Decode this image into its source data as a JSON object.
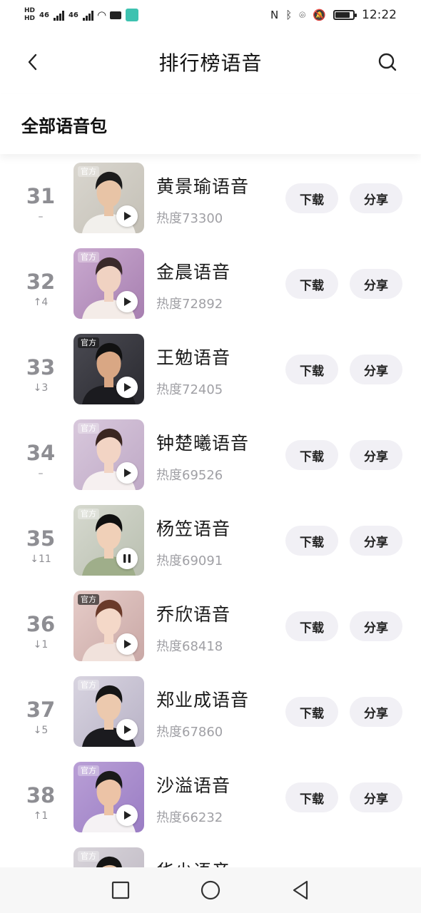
{
  "status": {
    "time": "12:22",
    "net1": "46",
    "net2": "46",
    "battery_level": 0.85
  },
  "header": {
    "title": "排行榜语音"
  },
  "section": {
    "title": "全部语音包"
  },
  "buttons": {
    "download": "下载",
    "share": "分享"
  },
  "badge_label": "官方",
  "items": [
    {
      "rank": "31",
      "change": "–",
      "name": "黄景瑜语音",
      "heat": "热度73300",
      "playing": false,
      "bg1": "#d9d6cf",
      "bg2": "#c4c0b6",
      "hair": "#1c1c1c",
      "skin": "#e8c4a6",
      "cloth": "#f2f0ec"
    },
    {
      "rank": "32",
      "change": "↑4",
      "name": "金晨语音",
      "heat": "热度72892",
      "playing": false,
      "bg1": "#c9a9cf",
      "bg2": "#a77fb0",
      "hair": "#3a2a2a",
      "skin": "#f0d2c2",
      "cloth": "#f4ece8"
    },
    {
      "rank": "33",
      "change": "↓3",
      "name": "王勉语音",
      "heat": "热度72405",
      "playing": false,
      "bg1": "#4a4a52",
      "bg2": "#2a2a30",
      "hair": "#111111",
      "skin": "#d9a784",
      "cloth": "#1b1b1f"
    },
    {
      "rank": "34",
      "change": "–",
      "name": "钟楚曦语音",
      "heat": "热度69526",
      "playing": false,
      "bg1": "#d8c8dc",
      "bg2": "#bfa9c6",
      "hair": "#3a2620",
      "skin": "#f2d4c4",
      "cloth": "#f6f0f0"
    },
    {
      "rank": "35",
      "change": "↓11",
      "name": "杨笠语音",
      "heat": "热度69091",
      "playing": true,
      "bg1": "#d6d9cf",
      "bg2": "#b9bfb0",
      "hair": "#101010",
      "skin": "#f0d0b8",
      "cloth": "#9fae8a"
    },
    {
      "rank": "36",
      "change": "↓1",
      "name": "乔欣语音",
      "heat": "热度68418",
      "playing": false,
      "bg1": "#e6ccc8",
      "bg2": "#c9a8a6",
      "hair": "#6a3a2a",
      "skin": "#f4d8c8",
      "cloth": "#f1e2dc"
    },
    {
      "rank": "37",
      "change": "↓5",
      "name": "郑业成语音",
      "heat": "热度67860",
      "playing": false,
      "bg1": "#d8d4e0",
      "bg2": "#b8b2c6",
      "hair": "#151515",
      "skin": "#ecc9ae",
      "cloth": "#1b1b1f"
    },
    {
      "rank": "38",
      "change": "↑1",
      "name": "沙溢语音",
      "heat": "热度66232",
      "playing": false,
      "bg1": "#b99fd6",
      "bg2": "#9a7dc4",
      "hair": "#1a1a1a",
      "skin": "#ecc3a6",
      "cloth": "#f5f2f4"
    },
    {
      "rank": "",
      "change": "",
      "name": "华少语音",
      "heat": "",
      "playing": false,
      "bg1": "#d8d4da",
      "bg2": "#bdb7c2",
      "hair": "#151515",
      "skin": "#e8c4a6",
      "cloth": "#222222"
    }
  ]
}
